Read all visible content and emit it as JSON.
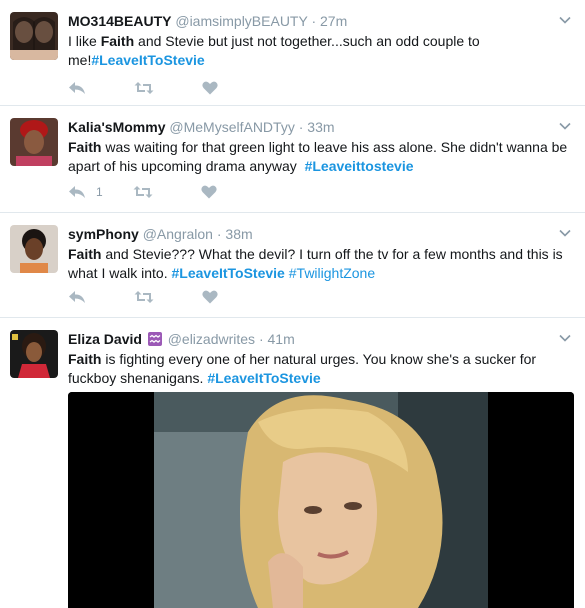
{
  "tweets": [
    {
      "name": "MO314BEAUTY",
      "handle": "@iamsimplyBEAUTY",
      "time": "27m",
      "text_before": "I like ",
      "bold": "Faith",
      "text_after": " and Stevie but just not together...such an odd couple to me!",
      "hashtags": [
        "#LeaveItToStevie"
      ],
      "reply_count": ""
    },
    {
      "name": "Kalia'sMommy",
      "handle": "@MeMyselfANDTyy",
      "time": "33m",
      "text_before": "",
      "bold": "Faith",
      "text_after": " was waiting for that green light to leave his ass alone. She didn't wanna be apart of his upcoming drama anyway  ",
      "hashtags": [
        "#Leaveittostevie"
      ],
      "reply_count": "1"
    },
    {
      "name": "symPhony",
      "handle": "@Angralon",
      "time": "38m",
      "text_before": "",
      "bold": "Faith",
      "text_after": " and Stevie??? What the devil? I turn off the tv for a few months and this is what I walk into. ",
      "hashtags": [
        "#LeaveItToStevie",
        "#TwilightZone"
      ],
      "reply_count": ""
    },
    {
      "name": "Eliza David",
      "handle": "@elizadwrites",
      "time": "41m",
      "text_before": "",
      "bold": "Faith",
      "text_after": " is fighting every one of her natural urges. You know she's a sucker for fuckboy shenanigans. ",
      "hashtags": [
        "#LeaveItToStevie"
      ],
      "reply_count": ""
    }
  ],
  "icons": {
    "reply": "reply-icon",
    "retweet": "retweet-icon",
    "like": "heart-icon",
    "more": "chevron-down-icon",
    "badge": "aquarius-icon"
  },
  "colors": {
    "hashtag": "#1b95e0",
    "muted": "#8899a6",
    "icon": "#aab8c2",
    "divider": "#e1e8ed"
  }
}
